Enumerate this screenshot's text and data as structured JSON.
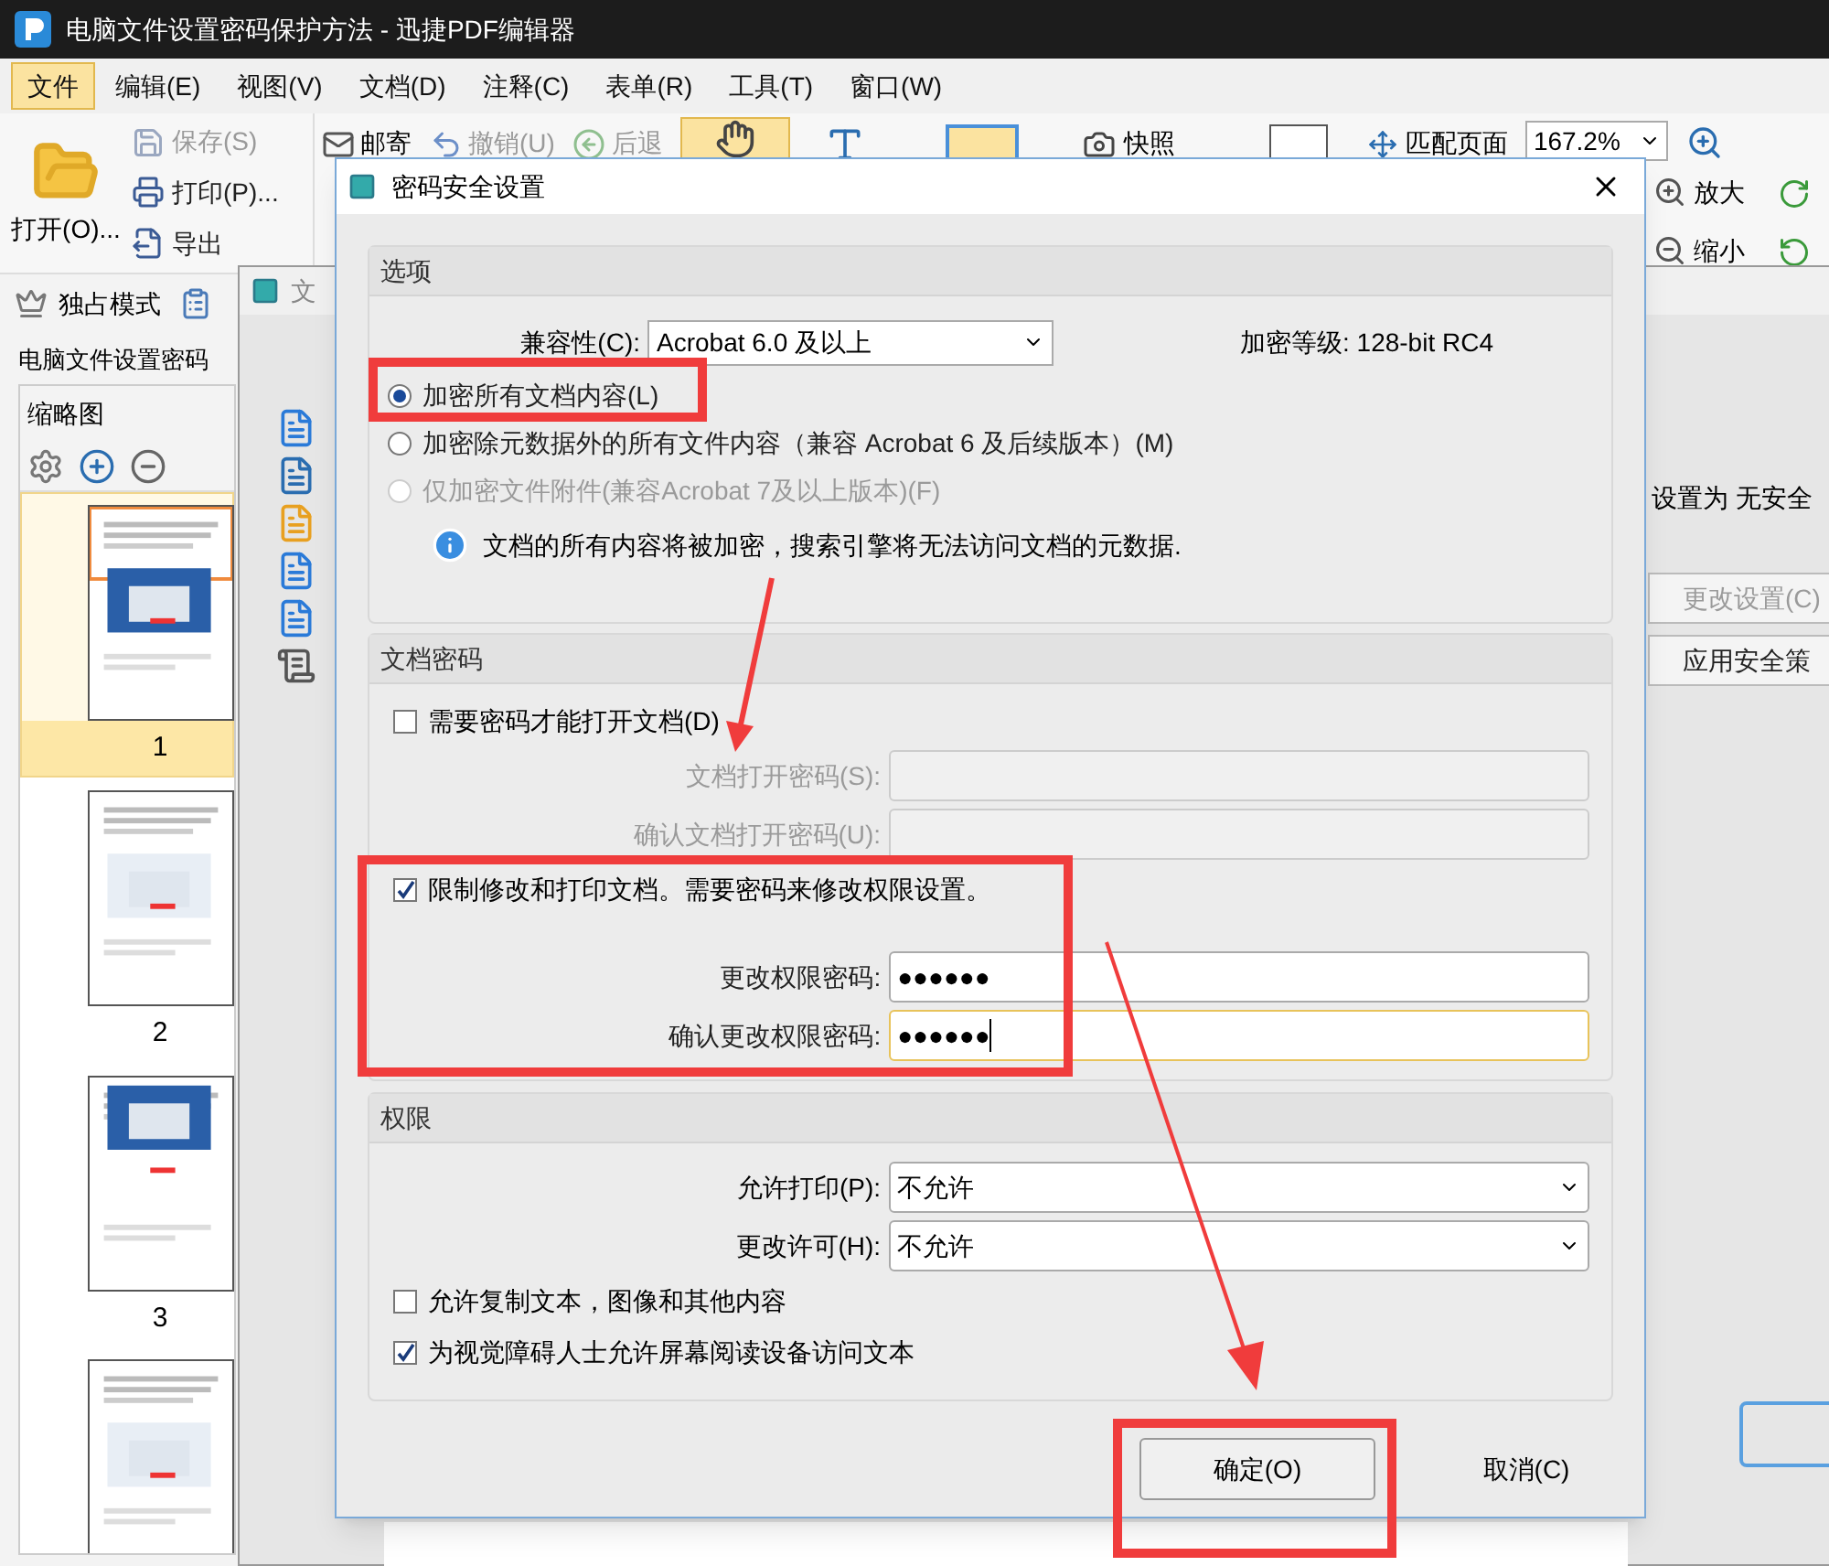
{
  "title": "电脑文件设置密码保护方法 - 迅捷PDF编辑器",
  "menu": [
    {
      "label": "文件",
      "selected": true
    },
    {
      "label": "编辑(E)",
      "selected": false
    },
    {
      "label": "视图(V)",
      "selected": false
    },
    {
      "label": "文档(D)",
      "selected": false
    },
    {
      "label": "注释(C)",
      "selected": false
    },
    {
      "label": "表单(R)",
      "selected": false
    },
    {
      "label": "工具(T)",
      "selected": false
    },
    {
      "label": "窗口(W)",
      "selected": false
    }
  ],
  "toolbar": {
    "open": "打开(O)...",
    "file_actions": [
      {
        "label": "保存(S)",
        "disabled": true
      },
      {
        "label": "打印(P)...",
        "disabled": false
      },
      {
        "label": "导出",
        "disabled": false
      }
    ],
    "mail": "邮寄",
    "undo": {
      "label": "撤销(U)",
      "disabled": true
    },
    "back": {
      "label": "后退",
      "disabled": true
    },
    "snapshot": "快照",
    "fit": "匹配页面",
    "zoom": "167.2%",
    "zoom_in": "放大",
    "zoom_out": "缩小"
  },
  "mode_bar": {
    "exclusive": "独占模式"
  },
  "doc_tab": "电脑文件设置密码",
  "thumbnails": {
    "title": "缩略图",
    "pages": [
      {
        "label": "1",
        "selected": true
      },
      {
        "label": "2",
        "selected": false
      },
      {
        "label": "3",
        "selected": false
      }
    ]
  },
  "background_window": {
    "title": "文",
    "status": "设置为 无安全",
    "buttons": [
      {
        "label": "更改设置(C)",
        "disabled": true
      },
      {
        "label": "应用安全策",
        "disabled": false
      }
    ]
  },
  "dialog": {
    "title": "密码安全设置",
    "options": {
      "heading": "选项",
      "compat_label": "兼容性(C):",
      "compat_value": "Acrobat 6.0 及以上",
      "level": "加密等级:  128-bit RC4",
      "radios": [
        {
          "label": "加密所有文档内容(L)",
          "selected": true,
          "disabled": false
        },
        {
          "label": "加密除元数据外的所有文件内容（兼容 Acrobat 6 及后续版本）(M)",
          "selected": false,
          "disabled": false
        },
        {
          "label": "仅加密文件附件(兼容Acrobat 7及以上版本)(F)",
          "selected": false,
          "disabled": true
        }
      ],
      "info": "文档的所有内容将被加密，搜索引擎将无法访问文档的元数据."
    },
    "password": {
      "heading": "文档密码",
      "items": [
        {
          "kind": "checkbox",
          "label": "需要密码才能打开文档(D)",
          "checked": false
        },
        {
          "kind": "field",
          "label": "文档打开密码(S):",
          "disabled": true,
          "focused": false
        },
        {
          "kind": "field",
          "label": "确认文档打开密码(U):",
          "disabled": true,
          "focused": false
        },
        {
          "kind": "checkbox",
          "label": "限制修改和打印文档。需要密码来修改权限设置。",
          "checked": true
        },
        {
          "kind": "field",
          "label": "更改权限密码:",
          "value": "●●●●●●",
          "disabled": false,
          "focused": false
        },
        {
          "kind": "field",
          "label": "确认更改权限密码:",
          "value": "●●●●●●",
          "disabled": false,
          "focused": true
        }
      ]
    },
    "permissions": {
      "heading": "权限",
      "items": [
        {
          "kind": "select",
          "label": "允许打印(P):",
          "value": "不允许"
        },
        {
          "kind": "select",
          "label": "更改许可(H):",
          "value": "不允许"
        },
        {
          "kind": "checkbox",
          "label": "允许复制文本，图像和其他内容",
          "checked": false
        },
        {
          "kind": "checkbox",
          "label": "为视觉障碍人士允许屏幕阅读设备访问文本",
          "checked": true
        }
      ]
    },
    "buttons": [
      "确定(O)",
      "取消(C)"
    ]
  }
}
